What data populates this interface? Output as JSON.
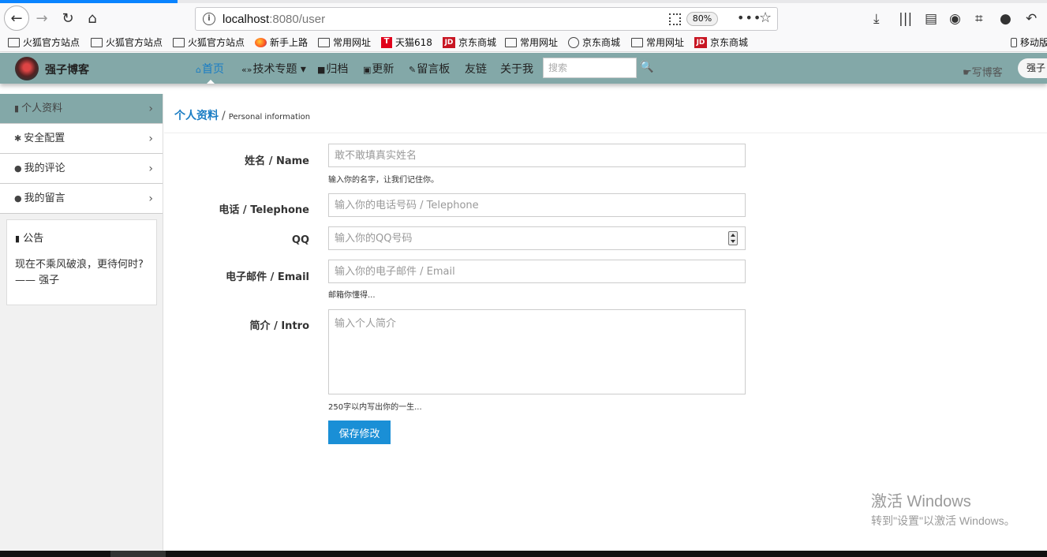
{
  "browser": {
    "url_host": "localhost",
    "url_rest": ":8080/user",
    "zoom": "80%",
    "bookmarks": [
      {
        "label": "火狐官方站点",
        "icon": "folder-icon"
      },
      {
        "label": "火狐官方站点",
        "icon": "folder-icon"
      },
      {
        "label": "火狐官方站点",
        "icon": "folder-icon"
      },
      {
        "label": "新手上路",
        "icon": "firefox-icon"
      },
      {
        "label": "常用网址",
        "icon": "folder-icon"
      },
      {
        "label": "天猫618",
        "icon": "tmall-icon",
        "badge": "T"
      },
      {
        "label": "京东商城",
        "icon": "jd-icon",
        "badge": "JD"
      },
      {
        "label": "常用网址",
        "icon": "folder-icon"
      },
      {
        "label": "京东商城",
        "icon": "globe-icon"
      },
      {
        "label": "常用网址",
        "icon": "folder-icon"
      },
      {
        "label": "京东商城",
        "icon": "jd-icon",
        "badge": "JD"
      }
    ],
    "mobile_bookmarks": "移动版"
  },
  "site": {
    "logo_text": "强子博客",
    "nav": [
      {
        "label": "首页",
        "icon": "home-icon",
        "glyph": "⌂"
      },
      {
        "label": "技术专题",
        "icon": "code-icon",
        "glyph": "«»"
      },
      {
        "label": "归档",
        "icon": "archive-icon",
        "glyph": "■"
      },
      {
        "label": "更新",
        "icon": "calendar-icon",
        "glyph": "▣"
      },
      {
        "label": "留言板",
        "icon": "pencil-icon",
        "glyph": "✎"
      },
      {
        "label": "友链",
        "icon": "",
        "glyph": ""
      },
      {
        "label": "关于我",
        "icon": "",
        "glyph": ""
      }
    ],
    "search_placeholder": "搜索",
    "write_blog": "写博客",
    "user_name": "强子"
  },
  "sidebar": {
    "items": [
      {
        "label": "个人资料",
        "icon": "file-icon",
        "glyph": "▮",
        "active": true
      },
      {
        "label": "安全配置",
        "icon": "cog-icon",
        "glyph": "✱",
        "active": false
      },
      {
        "label": "我的评论",
        "icon": "comment-icon",
        "glyph": "●",
        "active": false
      },
      {
        "label": "我的留言",
        "icon": "comments-icon",
        "glyph": "●",
        "active": false
      }
    ],
    "notice_title": "公告",
    "notice_body": "现在不乘风破浪，更待何时?\n—— 强子"
  },
  "main": {
    "breadcrumb_title": "个人资料",
    "breadcrumb_sep": "/",
    "breadcrumb_en": "Personal information",
    "form": {
      "name_label": "姓名 / Name",
      "name_placeholder": "敢不敢填真实姓名",
      "name_help": "输入你的名字，让我们记住你。",
      "phone_label": "电话 / Telephone",
      "phone_placeholder": "输入你的电话号码 / Telephone",
      "qq_label": "QQ",
      "qq_placeholder": "输入你的QQ号码",
      "email_label": "电子邮件 / Email",
      "email_placeholder": "输入你的电子邮件 / Email",
      "email_help": "邮箱你懂得...",
      "intro_label": "简介 / Intro",
      "intro_placeholder": "输入个人简介",
      "intro_help": "250字以内写出你的一生...",
      "save_label": "保存修改"
    }
  },
  "watermark": {
    "line1": "激活 Windows",
    "line2": "转到\"设置\"以激活 Windows。"
  }
}
